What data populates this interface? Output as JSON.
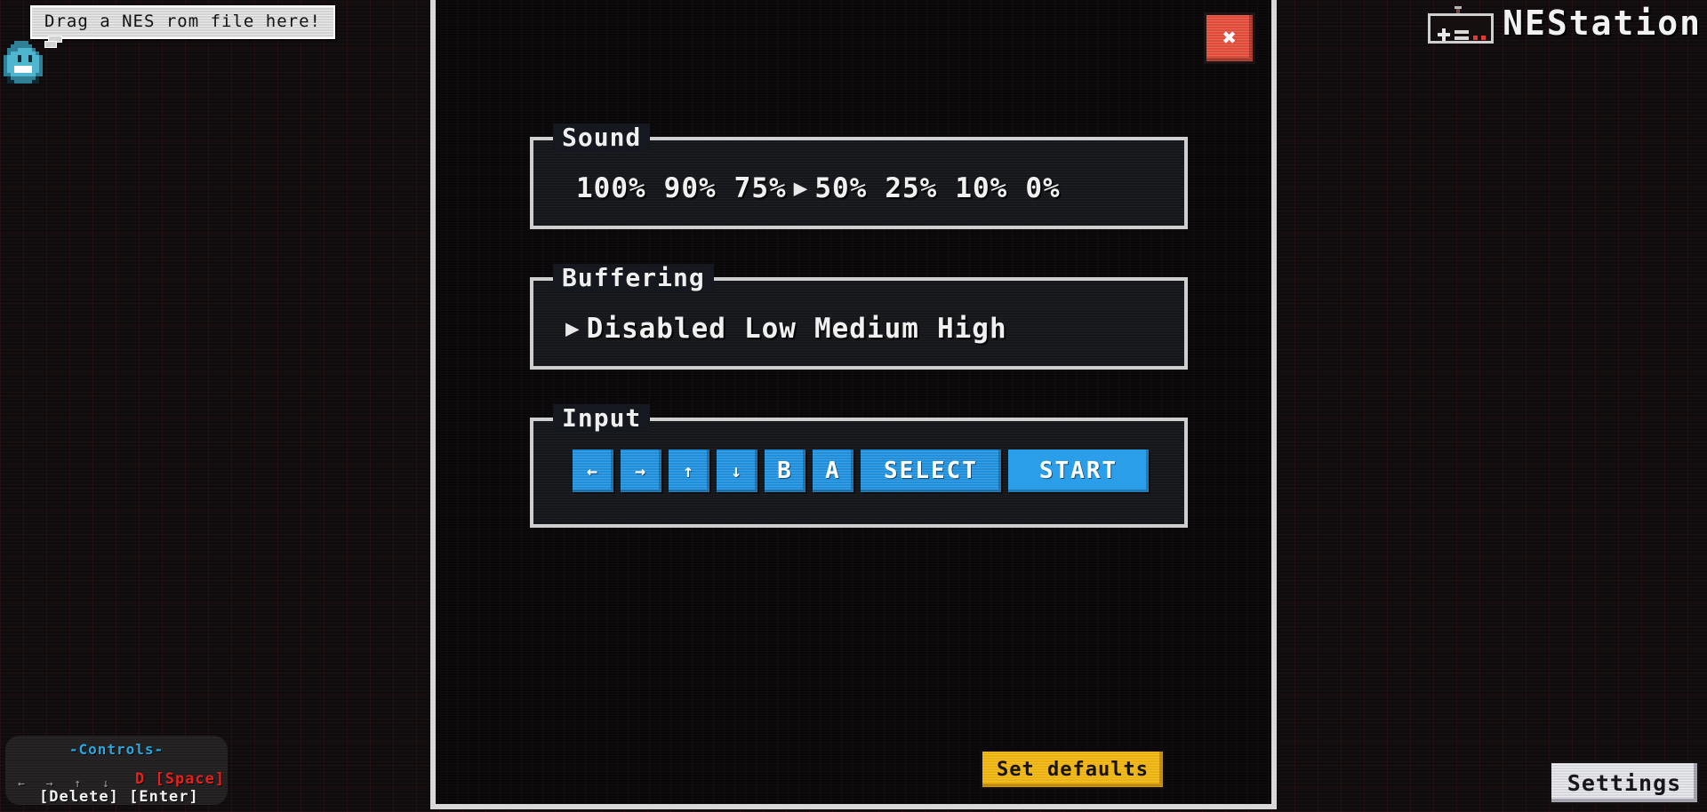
{
  "app": {
    "brand_name": "NEStation",
    "controller_icon": "nes-controller-icon"
  },
  "drop_hint": {
    "text": "Drag a NES rom file here!",
    "mascot_icon": "blob-mascot-icon"
  },
  "modal": {
    "close_label": "✖",
    "close_icon": "close-icon",
    "groups": {
      "sound": {
        "legend": "Sound",
        "selected": "50%",
        "cursor": "▶",
        "options": [
          "100%",
          "90%",
          "75%",
          "50%",
          "25%",
          "10%",
          "0%"
        ]
      },
      "buffering": {
        "legend": "Buffering",
        "selected": "Disabled",
        "cursor": "▶",
        "options": [
          "Disabled",
          "Low",
          "Medium",
          "High"
        ]
      },
      "input": {
        "legend": "Input",
        "keys": [
          {
            "label": "←",
            "name": "input-key-left",
            "wide": false,
            "arrow": true,
            "active": false
          },
          {
            "label": "→",
            "name": "input-key-right",
            "wide": false,
            "arrow": true,
            "active": false
          },
          {
            "label": "↑",
            "name": "input-key-up",
            "wide": false,
            "arrow": true,
            "active": false
          },
          {
            "label": "↓",
            "name": "input-key-down",
            "wide": false,
            "arrow": true,
            "active": false
          },
          {
            "label": "B",
            "name": "input-key-b",
            "wide": false,
            "arrow": false,
            "active": false
          },
          {
            "label": "A",
            "name": "input-key-a",
            "wide": false,
            "arrow": false,
            "active": false
          },
          {
            "label": "SELECT",
            "name": "input-key-select",
            "wide": true,
            "arrow": false,
            "active": false
          },
          {
            "label": "START",
            "name": "input-key-start",
            "wide": true,
            "arrow": false,
            "active": true
          }
        ]
      }
    },
    "set_defaults_label": "Set defaults"
  },
  "settings_button_label": "Settings",
  "controls_panel": {
    "title": "-Controls-",
    "arrows": "← → ↑ ↓",
    "action_keys": "D [Space]",
    "system_keys": "[Delete] [Enter]"
  },
  "colors": {
    "accent_blue": "#1f8fdc",
    "accent_yellow": "#edb10c",
    "close_red": "#e04a38",
    "controls_title": "#25a9e0",
    "controls_action": "#e8201c",
    "panel_border": "#cfcfcf",
    "background": "#100c0d"
  }
}
